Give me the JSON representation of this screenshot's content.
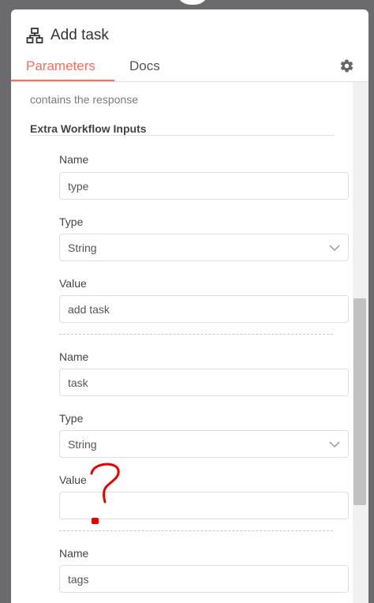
{
  "header": {
    "title": "Add task",
    "tabs": [
      {
        "label": "Parameters",
        "active": true
      },
      {
        "label": "Docs",
        "active": false
      }
    ]
  },
  "content": {
    "description_tail": "contains the response",
    "section_title": "Extra Workflow Inputs",
    "inputs": [
      {
        "name_label": "Name",
        "name_value": "type",
        "type_label": "Type",
        "type_value": "String",
        "value_label": "Value",
        "value_value": "add task"
      },
      {
        "name_label": "Name",
        "name_value": "task",
        "type_label": "Type",
        "type_value": "String",
        "value_label": "Value",
        "value_value": ""
      },
      {
        "name_label": "Name",
        "name_value": "tags"
      }
    ]
  },
  "colors": {
    "accent": "#ff6d5a",
    "annotation": "#e60000"
  },
  "icons": {
    "title": "workflow-node-icon",
    "settings": "gear-icon",
    "dropdown": "chevron-down-icon"
  }
}
